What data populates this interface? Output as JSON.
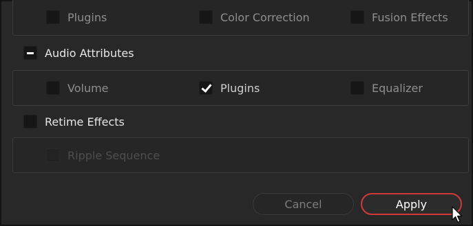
{
  "top_group": {
    "plugins_label": "Plugins",
    "color_correction_label": "Color Correction",
    "fusion_effects_label": "Fusion Effects"
  },
  "audio_attributes": {
    "label": "Audio Attributes",
    "state": "partial",
    "volume_label": "Volume",
    "volume_checked": false,
    "plugins_label": "Plugins",
    "plugins_checked": true,
    "equalizer_label": "Equalizer",
    "equalizer_checked": false
  },
  "retime_effects": {
    "label": "Retime Effects",
    "checked": false,
    "ripple_sequence_label": "Ripple Sequence",
    "ripple_sequence_enabled": false
  },
  "buttons": {
    "cancel_label": "Cancel",
    "apply_label": "Apply"
  },
  "colors": {
    "background": "#282828",
    "accent": "#d23a3a",
    "checkbox": "#161616"
  },
  "icons": {
    "check": "checkmark-icon",
    "partial": "minus-icon",
    "cursor": "mouse-pointer-icon"
  }
}
